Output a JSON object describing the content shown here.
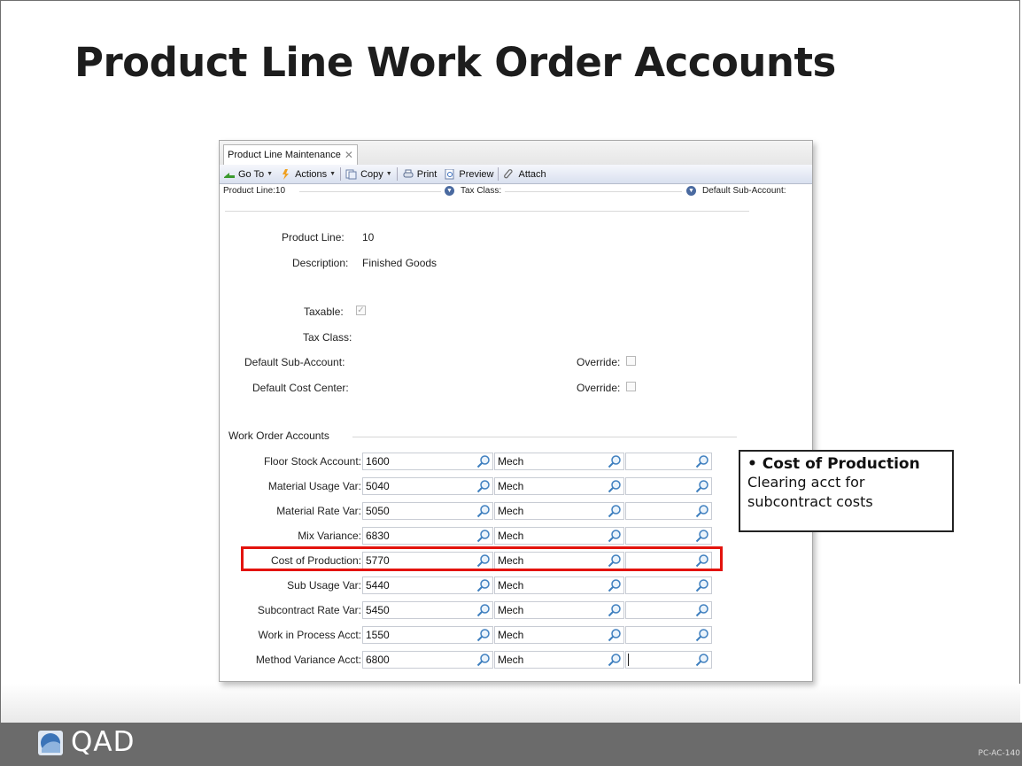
{
  "slide": {
    "title": "Product Line Work Order Accounts",
    "footer_logo": "QAD",
    "footer_code": "PC-AC-140"
  },
  "window": {
    "tab_label": "Product Line Maintenance",
    "toolbar": {
      "goto": "Go To",
      "actions": "Actions",
      "copy": "Copy",
      "print": "Print",
      "preview": "Preview",
      "attach": "Attach"
    },
    "infobar": {
      "product_line": "Product Line:10",
      "tax_class": "Tax Class:",
      "default_sub_account": "Default Sub-Account:"
    },
    "form": {
      "product_line_label": "Product Line:",
      "product_line_value": "10",
      "description_label": "Description:",
      "description_value": "Finished Goods",
      "taxable_label": "Taxable:",
      "taxable_checked": true,
      "tax_class_label": "Tax Class:",
      "default_sub_account_label": "Default Sub-Account:",
      "default_cost_center_label": "Default Cost Center:",
      "override_label": "Override:"
    },
    "work_order_accounts": {
      "group_label": "Work Order Accounts",
      "rows": [
        {
          "label": "Floor Stock Account:",
          "account": "1600",
          "sub_account": "Mech",
          "cost_center": ""
        },
        {
          "label": "Material Usage Var:",
          "account": "5040",
          "sub_account": "Mech",
          "cost_center": ""
        },
        {
          "label": "Material Rate Var:",
          "account": "5050",
          "sub_account": "Mech",
          "cost_center": ""
        },
        {
          "label": "Mix Variance:",
          "account": "6830",
          "sub_account": "Mech",
          "cost_center": ""
        },
        {
          "label": "Cost of Production:",
          "account": "5770",
          "sub_account": "Mech",
          "cost_center": ""
        },
        {
          "label": "Sub Usage Var:",
          "account": "5440",
          "sub_account": "Mech",
          "cost_center": ""
        },
        {
          "label": "Subcontract Rate Var:",
          "account": "5450",
          "sub_account": "Mech",
          "cost_center": ""
        },
        {
          "label": "Work in Process Acct:",
          "account": "1550",
          "sub_account": "Mech",
          "cost_center": ""
        },
        {
          "label": "Method Variance Acct:",
          "account": "6800",
          "sub_account": "Mech",
          "cost_center": ""
        }
      ]
    }
  },
  "callout": {
    "heading": "• Cost of Production",
    "line1": "Clearing acct for",
    "line2": "subcontract costs"
  },
  "colors": {
    "highlight": "#e3130d",
    "footer_bg": "#6b6b6b"
  },
  "icons": [
    "close-icon",
    "goto-icon",
    "actions-icon",
    "copy-icon",
    "print-icon",
    "preview-icon",
    "attach-icon",
    "expand-icon",
    "lookup-icon",
    "qad-logo-icon"
  ]
}
